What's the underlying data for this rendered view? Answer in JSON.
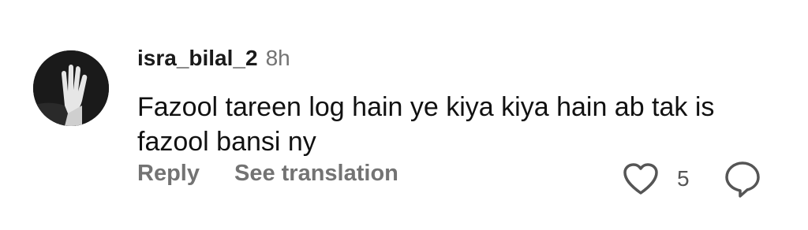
{
  "comment": {
    "username": "isra_bilal_2",
    "timestamp": "8h",
    "text": "Fazool tareen log hain ye kiya kiya hain ab tak is fazool bansi ny",
    "actions": {
      "reply_label": "Reply",
      "translate_label": "See translation"
    },
    "likes": {
      "count": "5",
      "icon": "heart-outline-icon"
    },
    "reply_icon": "speech-bubble-icon",
    "avatar_icon": "hand-photo-avatar"
  },
  "colors": {
    "text_primary": "#1a1a1a",
    "text_secondary": "#737373",
    "background": "#ffffff"
  }
}
